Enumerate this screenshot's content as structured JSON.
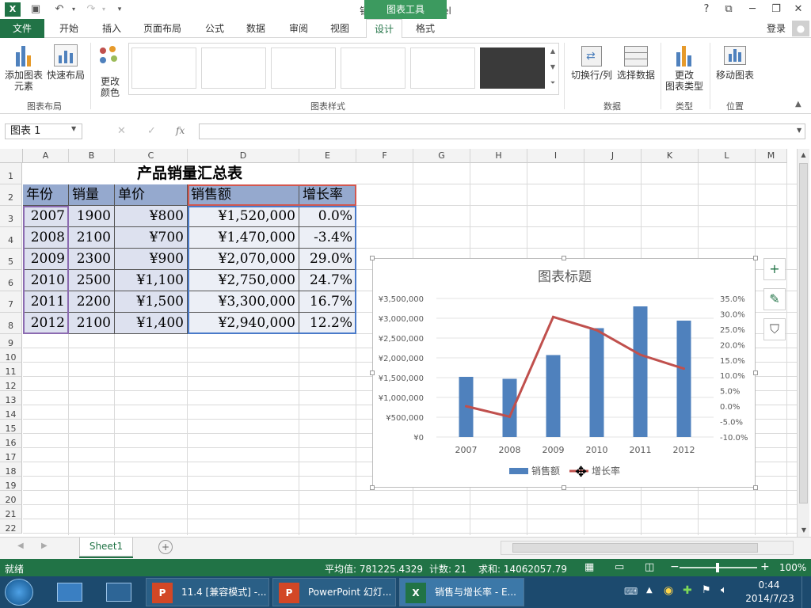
{
  "window": {
    "title": "销售与增长率 - Excel",
    "context_tab": "图表工具",
    "help": "?",
    "user": "登录"
  },
  "menu": {
    "file": "文件",
    "items": [
      "开始",
      "插入",
      "页面布局",
      "公式",
      "数据",
      "审阅",
      "视图"
    ],
    "context_items": [
      "设计",
      "格式"
    ]
  },
  "ribbon": {
    "add_element": [
      "添加图表",
      "元素"
    ],
    "quick_layout": "快速布局",
    "change_colors": [
      "更改",
      "颜色"
    ],
    "group_layout": "图表布局",
    "group_styles": "图表样式",
    "switch_row_col": "切换行/列",
    "select_data": "选择数据",
    "group_data": "数据",
    "change_type": [
      "更改",
      "图表类型"
    ],
    "group_type": "类型",
    "move_chart": "移动图表",
    "group_location": "位置"
  },
  "formula_bar": {
    "name_box": "图表 1",
    "fx": "fx",
    "formula": ""
  },
  "sheet": {
    "columns": [
      "A",
      "B",
      "C",
      "D",
      "E",
      "F",
      "G",
      "H",
      "I",
      "J",
      "K",
      "L",
      "M"
    ],
    "rows": [
      "1",
      "2",
      "3",
      "4",
      "5",
      "6",
      "7",
      "8",
      "9",
      "10",
      "11",
      "12",
      "13",
      "14",
      "15",
      "16",
      "17",
      "18",
      "19",
      "20",
      "21",
      "22"
    ],
    "table_title": "产品销量汇总表",
    "headers": [
      "年份",
      "销量",
      "单价",
      "销售额",
      "增长率"
    ],
    "data": [
      [
        "2007",
        "1900",
        "¥800",
        "¥1,520,000",
        "0.0%"
      ],
      [
        "2008",
        "2100",
        "¥700",
        "¥1,470,000",
        "-3.4%"
      ],
      [
        "2009",
        "2300",
        "¥900",
        "¥2,070,000",
        "29.0%"
      ],
      [
        "2010",
        "2500",
        "¥1,100",
        "¥2,750,000",
        "24.7%"
      ],
      [
        "2011",
        "2200",
        "¥1,500",
        "¥3,300,000",
        "16.7%"
      ],
      [
        "2012",
        "2100",
        "¥1,400",
        "¥2,940,000",
        "12.2%"
      ]
    ]
  },
  "chart_data": {
    "type": "bar",
    "title": "图表标题",
    "categories": [
      "2007",
      "2008",
      "2009",
      "2010",
      "2011",
      "2012"
    ],
    "series": [
      {
        "name": "销售额",
        "type": "bar",
        "axis": "left",
        "values": [
          1520000,
          1470000,
          2070000,
          2750000,
          3300000,
          2940000
        ],
        "color": "#4f81bd"
      },
      {
        "name": "增长率",
        "type": "line",
        "axis": "right",
        "values": [
          0.0,
          -3.4,
          29.0,
          24.7,
          16.7,
          12.2
        ],
        "color": "#c0504d"
      }
    ],
    "y_left_ticks": [
      "¥3,500,000",
      "¥3,000,000",
      "¥2,500,000",
      "¥2,000,000",
      "¥1,500,000",
      "¥1,000,000",
      "¥500,000",
      "¥0"
    ],
    "y_left_range": [
      0,
      3500000
    ],
    "y_right_ticks": [
      "35.0%",
      "30.0%",
      "25.0%",
      "20.0%",
      "15.0%",
      "10.0%",
      "5.0%",
      "0.0%",
      "-5.0%",
      "-10.0%"
    ],
    "y_right_range": [
      -10,
      35
    ],
    "legend": "bottom"
  },
  "sheet_tabs": {
    "active": "Sheet1"
  },
  "status": {
    "ready": "就绪",
    "average": "平均值: 781225.4329",
    "count": "计数: 21",
    "sum": "求和: 14062057.79",
    "zoom": "100%"
  },
  "taskbar": {
    "items": [
      "11.4 [兼容模式] -...",
      "PowerPoint 幻灯...",
      "销售与增长率 - E..."
    ],
    "time": "0:44",
    "date": "2014/7/23"
  }
}
